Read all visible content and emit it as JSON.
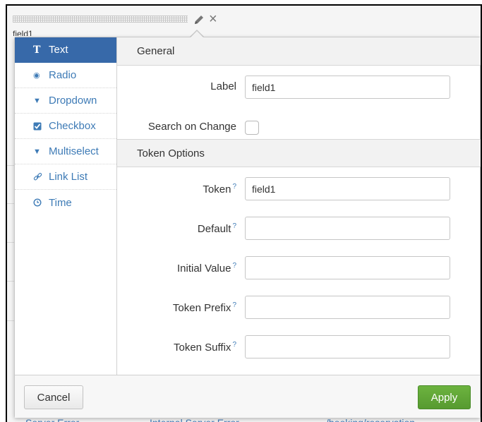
{
  "panel": {
    "field_label": "field1"
  },
  "icons": {
    "edit": "pencil-icon",
    "close": "close-icon"
  },
  "background_table": {
    "bottom_row": [
      "Server Error",
      "Internal Server Error",
      "/booking/reservation"
    ]
  },
  "input_types": [
    {
      "label": "Text",
      "icon": "text-icon",
      "active": true
    },
    {
      "label": "Radio",
      "icon": "radio-icon",
      "active": false
    },
    {
      "label": "Dropdown",
      "icon": "caret-down-icon",
      "active": false
    },
    {
      "label": "Checkbox",
      "icon": "checkbox-icon",
      "active": false
    },
    {
      "label": "Multiselect",
      "icon": "caret-down-icon",
      "active": false
    },
    {
      "label": "Link List",
      "icon": "link-icon",
      "active": false
    },
    {
      "label": "Time",
      "icon": "clock-icon",
      "active": false
    }
  ],
  "general": {
    "title": "General",
    "label_label": "Label",
    "label_value": "field1",
    "search_on_change_label": "Search on Change",
    "search_on_change_checked": false
  },
  "token_options": {
    "title": "Token Options",
    "help_mark": "?",
    "token_label": "Token",
    "token_value": "field1",
    "default_label": "Default",
    "default_value": "",
    "initial_value_label": "Initial Value",
    "initial_value_value": "",
    "token_prefix_label": "Token Prefix",
    "token_prefix_value": "",
    "token_suffix_label": "Token Suffix",
    "token_suffix_value": ""
  },
  "footer": {
    "cancel_label": "Cancel",
    "apply_label": "Apply"
  },
  "colors": {
    "active_tab": "#3769a9",
    "link": "#3e7bb6",
    "apply": "#5ea536"
  }
}
